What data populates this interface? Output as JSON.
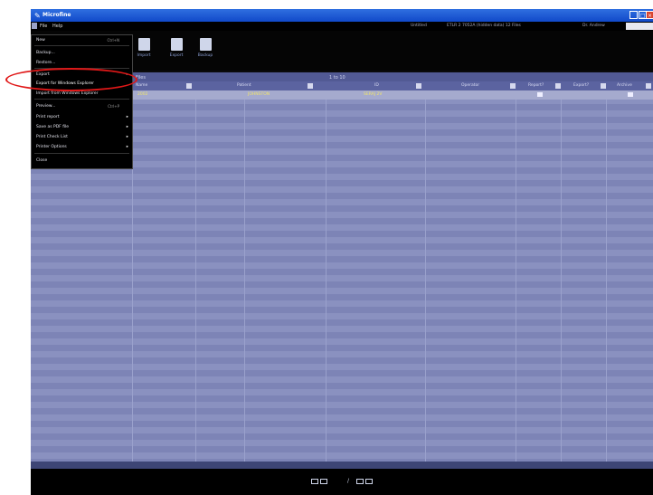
{
  "window": {
    "title": "Microfine"
  },
  "menubar": {
    "file": "File",
    "help": "Help"
  },
  "infobar": {
    "field1": "Untitled",
    "field2": "ETLR 2 7052A (hidden data) 12 Files",
    "user": "Dr. Andrew"
  },
  "toolbar": {
    "buttons": [
      {
        "label": "Import"
      },
      {
        "label": "Export"
      },
      {
        "label": "Backup"
      }
    ]
  },
  "grid": {
    "caption_left": "Files",
    "caption_mid": "1 to 10",
    "columns": [
      "Name",
      "Patient",
      "ID",
      "Operator",
      "Report?",
      "Export?",
      "Archive"
    ],
    "rows": [
      {
        "name": "2002",
        "patient": "JOHNSTON",
        "id": "SERAJ 2V"
      }
    ]
  },
  "menu": {
    "items": [
      {
        "label": "New",
        "shortcut": "Ctrl+N"
      },
      {
        "label": "Backup..."
      },
      {
        "label": "Restore..."
      },
      {
        "label": "Export"
      },
      {
        "label": "Export for Windows Explorer"
      },
      {
        "label": "Import from Windows Explorer"
      },
      {
        "label": "Preview...",
        "shortcut": "Ctrl+P"
      },
      {
        "label": "Print report"
      },
      {
        "label": "Save as PDF file"
      },
      {
        "label": "Print Check List"
      },
      {
        "label": "Printer Options"
      },
      {
        "label": "Close"
      }
    ]
  }
}
